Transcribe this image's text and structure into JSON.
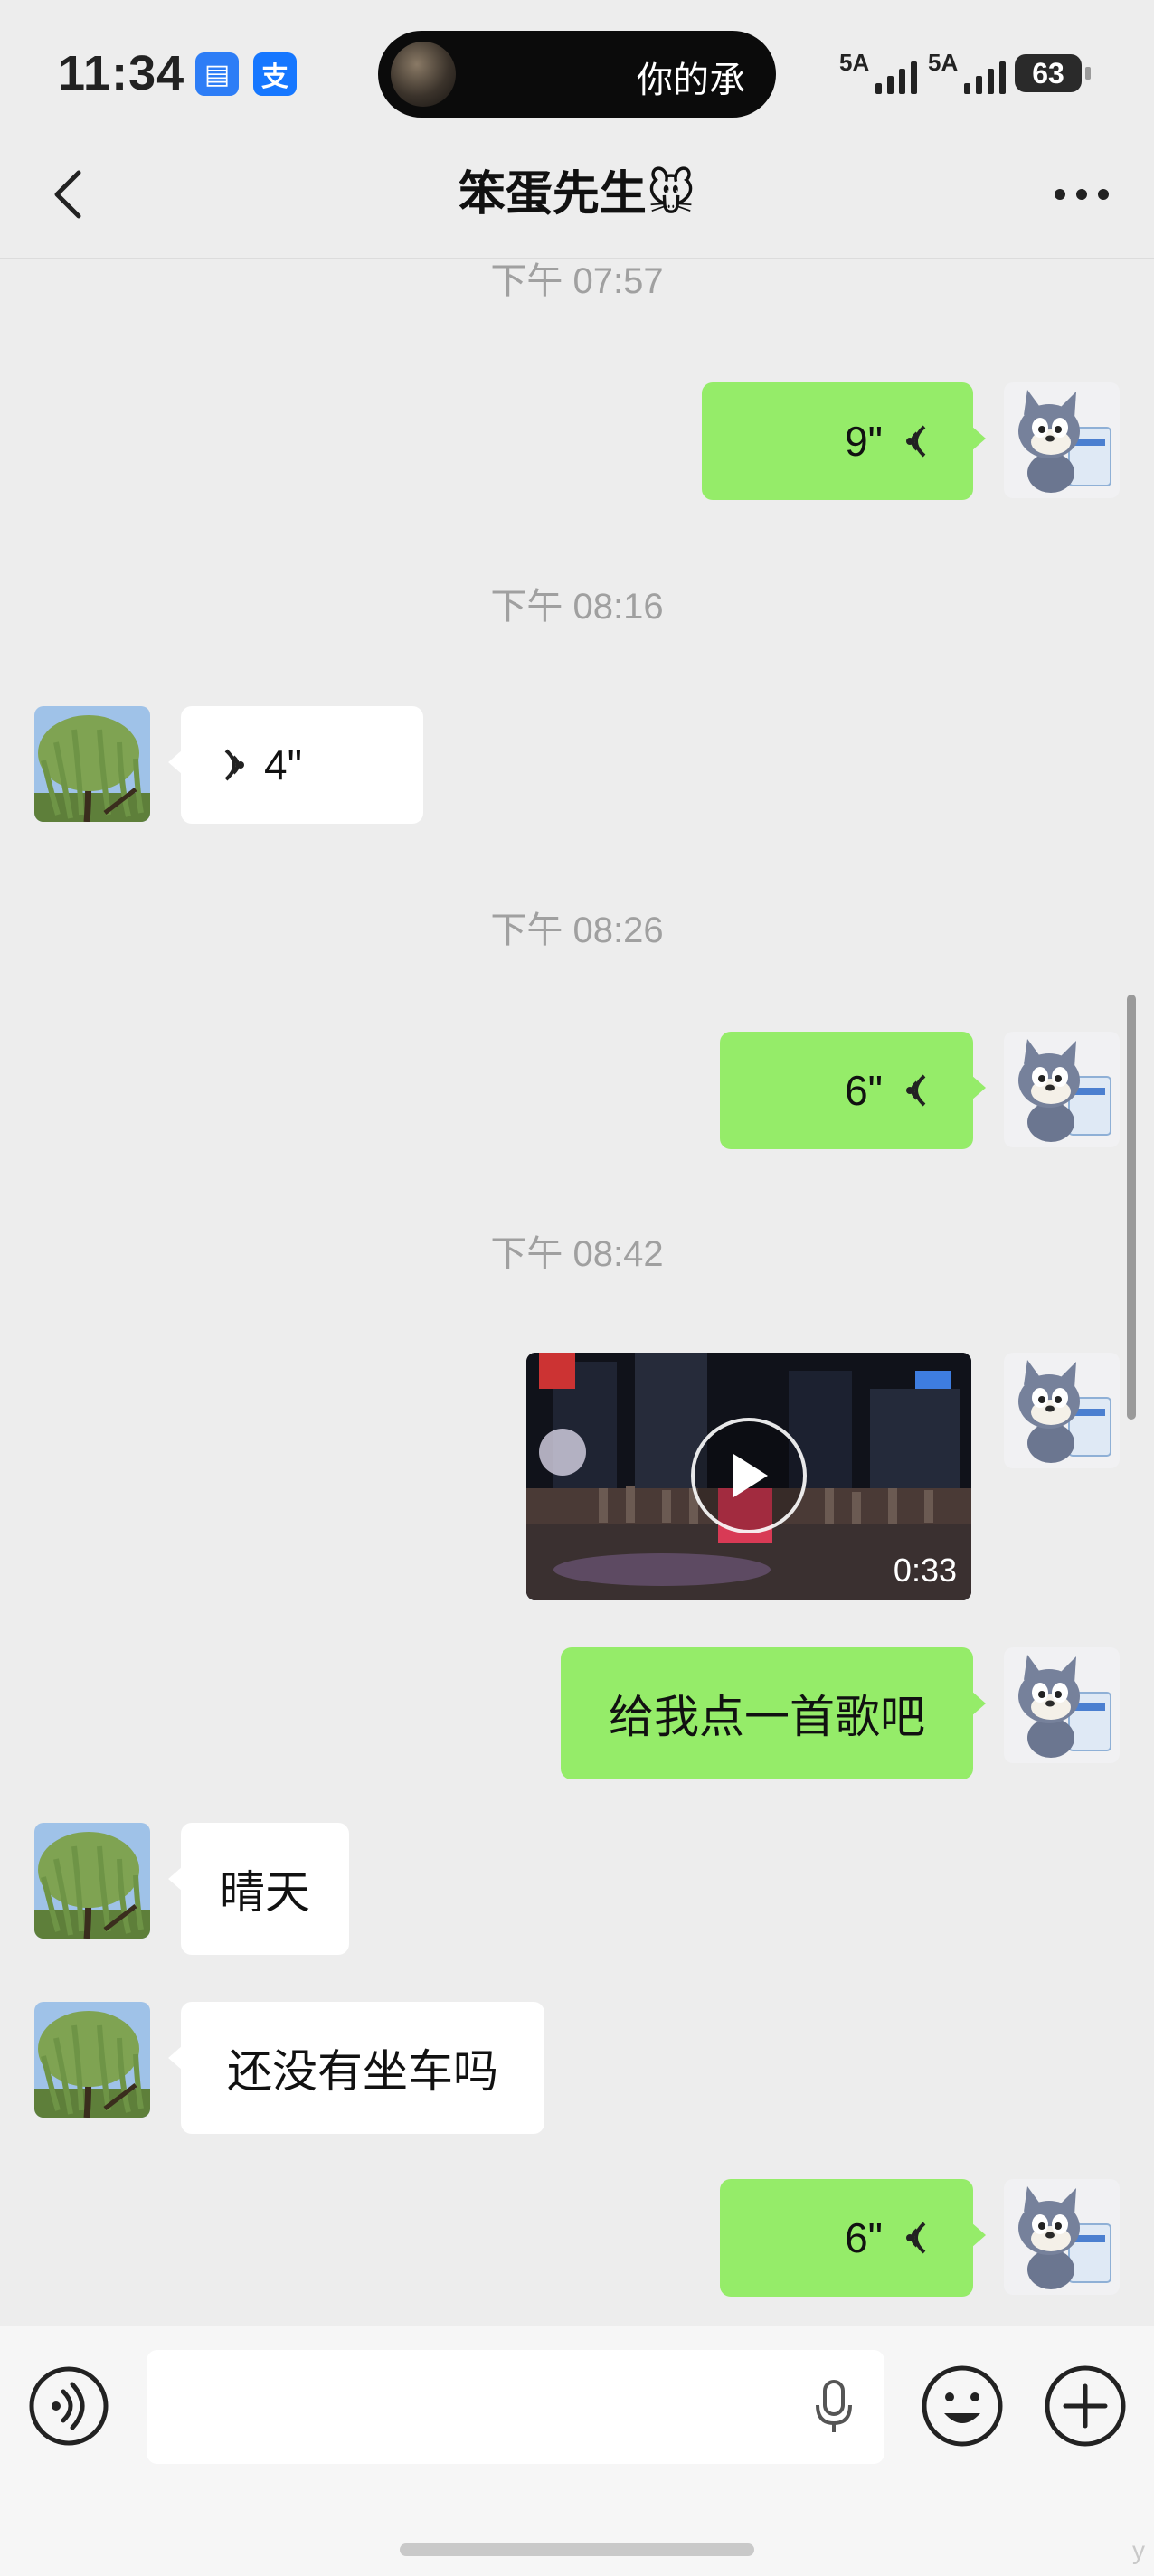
{
  "status_bar": {
    "time": "11:34",
    "app_badge_1": "▤",
    "app_badge_2": "支",
    "now_playing": "你的承",
    "signal_1": "5A",
    "signal_2": "5A",
    "battery": "63"
  },
  "header": {
    "title": "笨蛋先生🐭"
  },
  "chat": {
    "timestamps": [
      "下午 07:57",
      "下午 08:16",
      "下午 08:26",
      "下午 08:42"
    ],
    "messages": [
      {
        "from": "me",
        "type": "voice",
        "duration": "9\""
      },
      {
        "from": "contact",
        "type": "voice",
        "duration": "4\""
      },
      {
        "from": "me",
        "type": "voice",
        "duration": "6\""
      },
      {
        "from": "me",
        "type": "video",
        "duration": "0:33"
      },
      {
        "from": "me",
        "type": "text",
        "text": "给我点一首歌吧"
      },
      {
        "from": "contact",
        "type": "text",
        "text": "晴天"
      },
      {
        "from": "contact",
        "type": "text",
        "text": "还没有坐车吗"
      },
      {
        "from": "me",
        "type": "voice",
        "duration": "6\""
      }
    ]
  },
  "input_bar": {
    "placeholder": "",
    "corner_text": "y"
  },
  "colors": {
    "background": "#ededed",
    "my_bubble": "#95ec69",
    "their_bubble": "#ffffff",
    "timestamp": "#a0a0a0"
  },
  "icons": [
    "back-icon",
    "more-icon",
    "voice-mode-icon",
    "microphone-icon",
    "emoji-icon",
    "plus-icon",
    "play-icon",
    "voice-wave-icon"
  ]
}
